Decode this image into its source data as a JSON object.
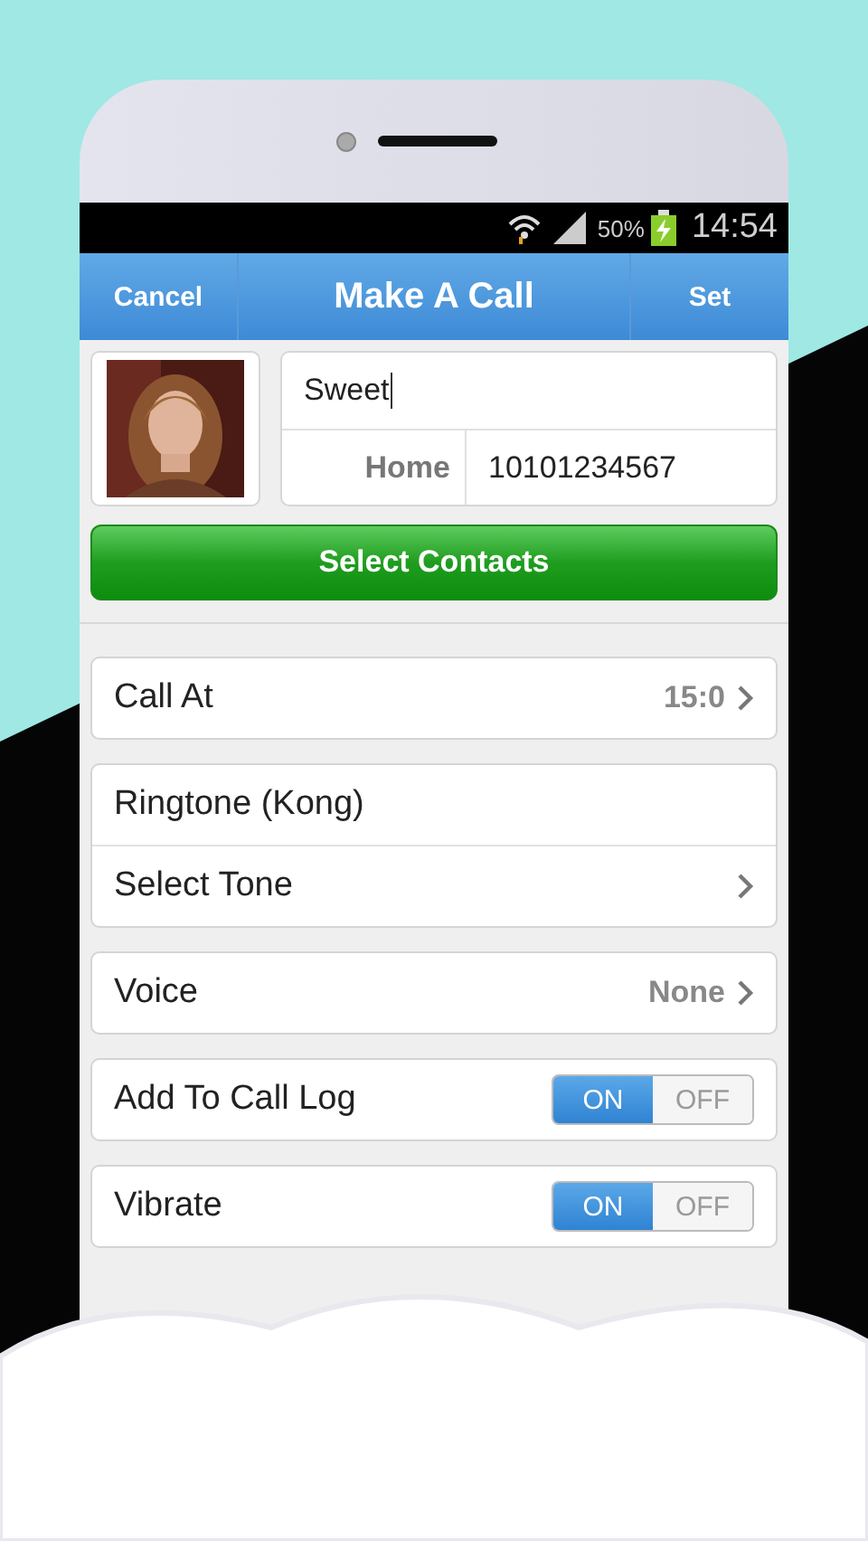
{
  "status_bar": {
    "battery": "50%",
    "time": "14:54"
  },
  "header": {
    "left_button": "Cancel",
    "title": "Make A Call",
    "right_button": "Set"
  },
  "contact": {
    "name": "Sweet",
    "phone_label": "Home",
    "phone_number": "10101234567"
  },
  "select_button": "Select Contacts",
  "groups": [
    {
      "rows": [
        {
          "kind": "value",
          "label": "Call At",
          "value": "15:0"
        }
      ]
    },
    {
      "rows": [
        {
          "kind": "plain",
          "label": "Ringtone (Kong)"
        },
        {
          "kind": "link",
          "label": "Select Tone"
        }
      ]
    },
    {
      "rows": [
        {
          "kind": "value",
          "label": "Voice",
          "value": "None"
        }
      ]
    },
    {
      "rows": [
        {
          "kind": "toggle",
          "label": "Add To Call Log",
          "on": true,
          "on_text": "ON",
          "off_text": "OFF"
        }
      ]
    },
    {
      "rows": [
        {
          "kind": "toggle",
          "label": "Vibrate",
          "on": true,
          "on_text": "ON",
          "off_text": "OFF"
        }
      ]
    }
  ]
}
